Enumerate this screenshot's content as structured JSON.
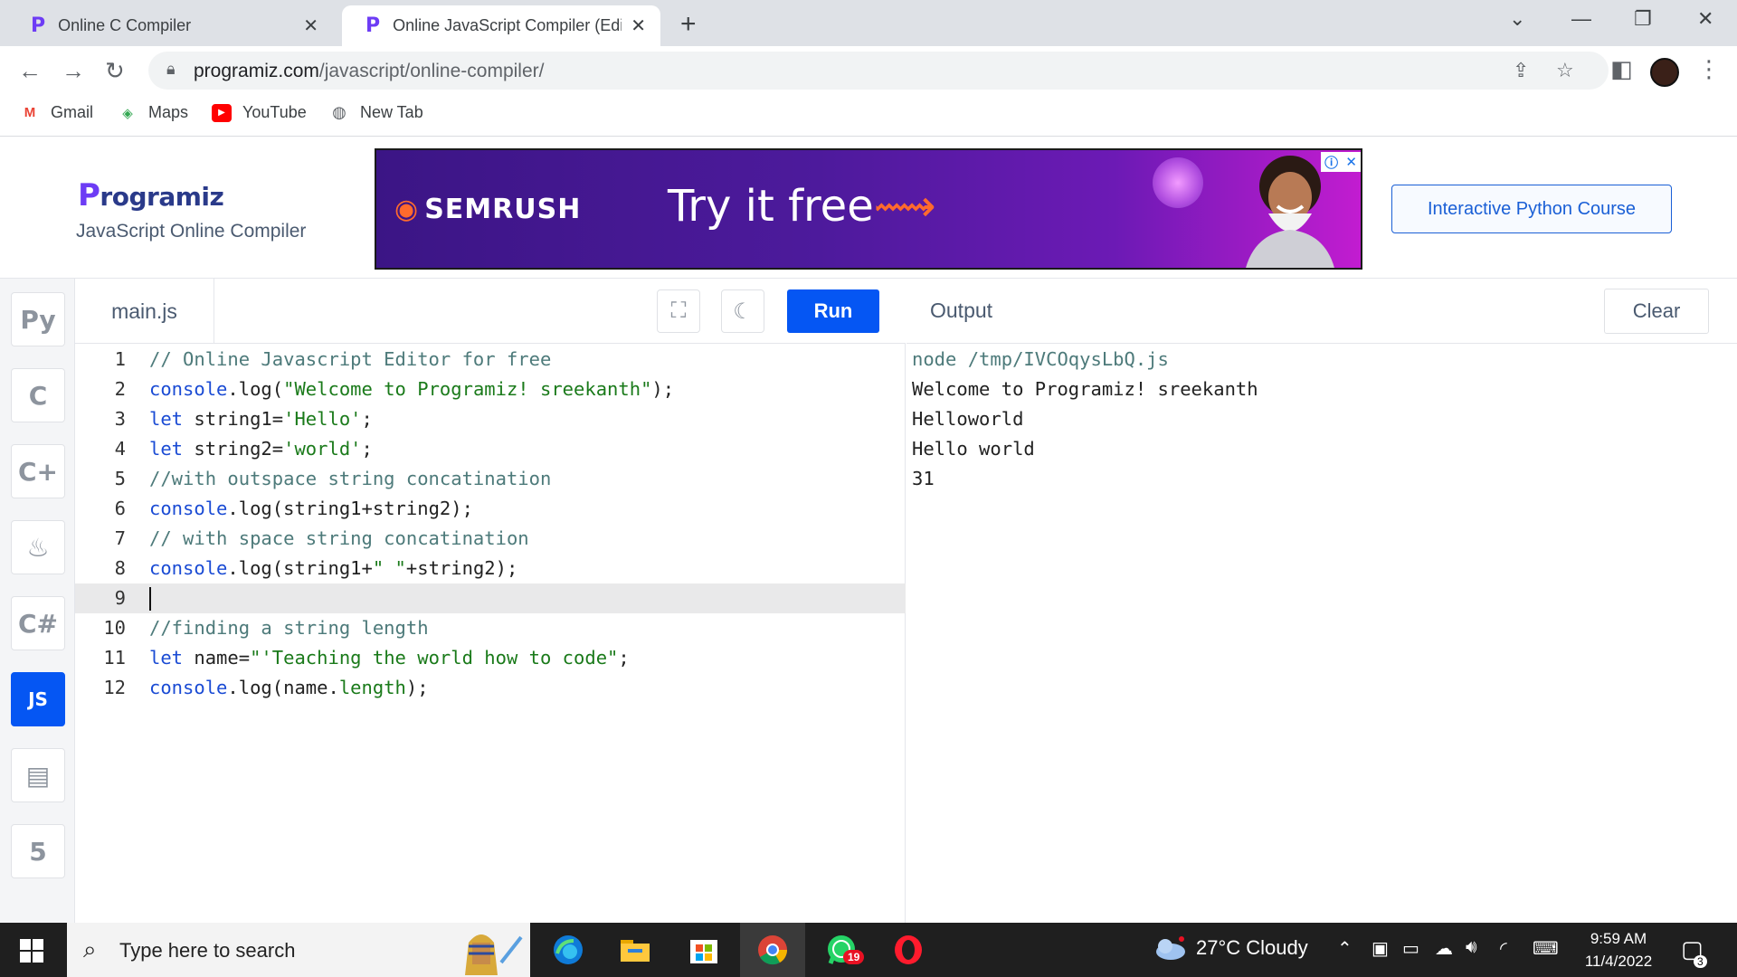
{
  "browser": {
    "tabs": [
      {
        "title": "Online C Compiler"
      },
      {
        "title": "Online JavaScript Compiler (Editor)"
      }
    ],
    "close_glyph": "✕",
    "new_tab_glyph": "+",
    "url_domain": "programiz.com",
    "url_path": "/javascript/online-compiler/",
    "bookmarks": [
      {
        "label": "Gmail",
        "icon": "gmail-icon"
      },
      {
        "label": "Maps",
        "icon": "maps-icon"
      },
      {
        "label": "YouTube",
        "icon": "youtube-icon"
      },
      {
        "label": "New Tab",
        "icon": "globe-icon"
      }
    ]
  },
  "site": {
    "brand_first": "P",
    "brand_rest": "rogramiz",
    "subtitle": "JavaScript Online Compiler",
    "ad": {
      "brand": "SEMRUSH",
      "cta": "Try it free"
    },
    "course_button": "Interactive Python Course"
  },
  "languages": [
    {
      "name": "python",
      "icon": "python-icon",
      "glyph": "Py"
    },
    {
      "name": "c",
      "icon": "c-icon",
      "glyph": "C"
    },
    {
      "name": "cpp",
      "icon": "cpp-icon",
      "glyph": "C+"
    },
    {
      "name": "java",
      "icon": "java-icon",
      "glyph": "♨"
    },
    {
      "name": "csharp",
      "icon": "csharp-icon",
      "glyph": "C#"
    },
    {
      "name": "javascript",
      "icon": "js-icon",
      "glyph": "JS",
      "active": true
    },
    {
      "name": "sql",
      "icon": "database-icon",
      "glyph": "▤"
    },
    {
      "name": "html",
      "icon": "html5-icon",
      "glyph": "5"
    }
  ],
  "editor": {
    "file_name": "main.js",
    "run_label": "Run",
    "current_line": 9,
    "lines": [
      [
        {
          "t": "// Online Javascript Editor for free",
          "c": "cmt"
        }
      ],
      [
        {
          "t": "console",
          "c": "kw"
        },
        {
          "t": ".log(",
          "c": "pl"
        },
        {
          "t": "\"Welcome to Programiz! sreekanth\"",
          "c": "str"
        },
        {
          "t": ");",
          "c": "pl"
        }
      ],
      [
        {
          "t": "let",
          "c": "kw"
        },
        {
          "t": " string1=",
          "c": "pl"
        },
        {
          "t": "'Hello'",
          "c": "str"
        },
        {
          "t": ";",
          "c": "pl"
        }
      ],
      [
        {
          "t": "let",
          "c": "kw"
        },
        {
          "t": " string2=",
          "c": "pl"
        },
        {
          "t": "'world'",
          "c": "str"
        },
        {
          "t": ";",
          "c": "pl"
        }
      ],
      [
        {
          "t": "//with outspace string concatination",
          "c": "cmt"
        }
      ],
      [
        {
          "t": "console",
          "c": "kw"
        },
        {
          "t": ".log(string1+string2);",
          "c": "pl"
        }
      ],
      [
        {
          "t": "// with space string concatination",
          "c": "cmt"
        }
      ],
      [
        {
          "t": "console",
          "c": "kw"
        },
        {
          "t": ".log(string1+",
          "c": "pl"
        },
        {
          "t": "\" \"",
          "c": "str"
        },
        {
          "t": "+string2);",
          "c": "pl"
        }
      ],
      [],
      [
        {
          "t": "//finding a string length",
          "c": "cmt"
        }
      ],
      [
        {
          "t": "let",
          "c": "kw"
        },
        {
          "t": " name=",
          "c": "pl"
        },
        {
          "t": "\"'Teaching the world how to code\"",
          "c": "str"
        },
        {
          "t": ";",
          "c": "pl"
        }
      ],
      [
        {
          "t": "console",
          "c": "kw"
        },
        {
          "t": ".log(name.",
          "c": "pl"
        },
        {
          "t": "length",
          "c": "prop"
        },
        {
          "t": ");",
          "c": "pl"
        }
      ]
    ]
  },
  "output": {
    "title": "Output",
    "clear_label": "Clear",
    "command": "node /tmp/IVCOqysLbQ.js",
    "lines": [
      "Welcome to Programiz! sreekanth",
      "Helloworld",
      "Hello world",
      "31"
    ]
  },
  "taskbar": {
    "search_placeholder": "Type here to search",
    "whatsapp_badge": "19",
    "weather": "27°C  Cloudy",
    "time": "9:59 AM",
    "date": "11/4/2022",
    "notification_count": "3"
  },
  "colors": {
    "accent": "#0556f3",
    "brand": "#6d3cf5",
    "comment": "#4d7a7a",
    "keyword": "#1a4bd4",
    "string": "#1a7a1a"
  }
}
